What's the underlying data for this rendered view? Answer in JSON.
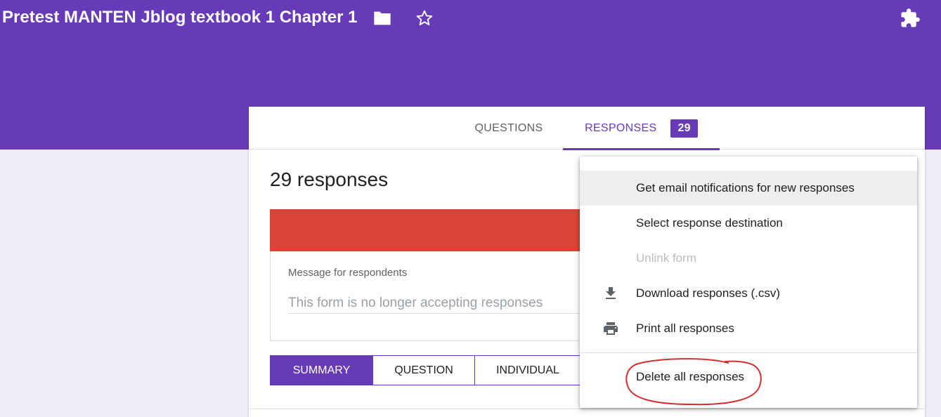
{
  "header": {
    "title": "Pretest MANTEN Jblog textbook 1 Chapter 1",
    "icons": [
      "folder-icon",
      "star-icon",
      "puzzle-icon"
    ],
    "background_color": "#673ab7"
  },
  "tabs": {
    "questions_label": "QUESTIONS",
    "responses_label": "RESPONSES",
    "responses_count": "29"
  },
  "responses": {
    "count_heading": "29 responses",
    "accepting_bar_color": "#db4437",
    "message_label": "Message for respondents",
    "message_placeholder": "This form is no longer accepting responses",
    "message_value": ""
  },
  "view_toggle": {
    "summary": "SUMMARY",
    "question": "QUESTION",
    "individual": "INDIVIDUAL",
    "selected": "SUMMARY"
  },
  "menu": {
    "email_notifications": "Get email notifications for new responses",
    "select_destination": "Select response destination",
    "unlink_form": "Unlink form",
    "download_csv": "Download responses (.csv)",
    "print_all": "Print all responses",
    "delete_all": "Delete all responses",
    "icons": [
      "download-icon",
      "print-icon"
    ]
  },
  "colors": {
    "accent": "#673ab7",
    "page_background": "#efebf7",
    "annotation_circle": "#d32f2f"
  }
}
